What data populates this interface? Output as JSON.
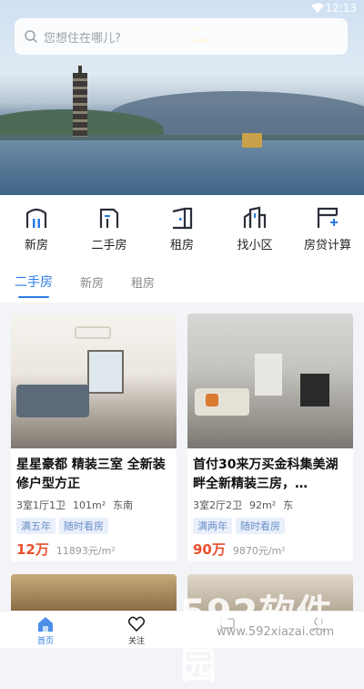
{
  "status": {
    "time": "12:13"
  },
  "search": {
    "placeholder": "您想住在哪儿?"
  },
  "quick_nav": [
    {
      "label": "新房",
      "icon": "new-house-icon"
    },
    {
      "label": "二手房",
      "icon": "secondhand-house-icon"
    },
    {
      "label": "租房",
      "icon": "rent-icon"
    },
    {
      "label": "找小区",
      "icon": "community-icon"
    },
    {
      "label": "房贷计算",
      "icon": "calculator-icon"
    }
  ],
  "tabs": [
    {
      "label": "二手房",
      "active": true
    },
    {
      "label": "新房",
      "active": false
    },
    {
      "label": "租房",
      "active": false
    }
  ],
  "listings": [
    {
      "title": "星星豪都 精装三室 全新装修户型方正",
      "layout": "3室1厅1卫",
      "area": "101m²",
      "orientation": "东南",
      "tags": [
        "满五年",
        "随时看房"
      ],
      "price": "12万",
      "unit_price": "11893元/m²"
    },
    {
      "title": "首付30来万买金科集美湖畔全新精装三房，…",
      "layout": "3室2厅2卫",
      "area": "92m²",
      "orientation": "东",
      "tags": [
        "满两年",
        "随时看房"
      ],
      "price": "90万",
      "unit_price": "9870元/m²"
    }
  ],
  "bottom_nav": [
    {
      "label": "首页",
      "icon": "home-icon"
    },
    {
      "label": "关注",
      "icon": "heart-icon"
    },
    {
      "label": "",
      "icon": "message-icon"
    },
    {
      "label": "",
      "icon": "profile-icon"
    }
  ],
  "watermark": {
    "brand": "592软件园",
    "url": "www.592xiazai.com"
  },
  "colors": {
    "accent": "#2c7be5",
    "price": "#e8502e",
    "tag_bg": "#e9f0fb"
  }
}
